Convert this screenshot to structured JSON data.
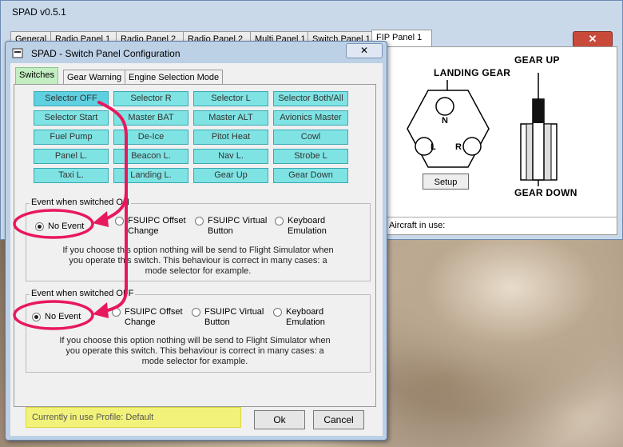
{
  "main_window": {
    "title": "SPAD    v0.5.1",
    "tabs": [
      "General",
      "Radio Panel 1",
      "Radio Panel 2",
      "Radio Panel 2",
      "Multi Panel 1",
      "Switch Panel 1",
      "FIP Panel 1"
    ],
    "active_tab": "Switch Panel 1",
    "close_label": "✕",
    "gear_panel": {
      "landing_gear_label": "LANDING GEAR",
      "gear_up_label": "GEAR UP",
      "gear_down_label": "GEAR DOWN",
      "nose_label": "N",
      "left_label": "L",
      "right_label": "R",
      "setup_label": "Setup"
    },
    "aircraft_label": "Aircraft in use:"
  },
  "dialog": {
    "title": "SPAD - Switch Panel Configuration",
    "close_label": "✕",
    "tabs": [
      "Switches",
      "Gear Warning",
      "Engine Selection Mode"
    ],
    "active_tab": "Switches",
    "switches": [
      [
        "Selector OFF",
        "Selector R",
        "Selector L",
        "Selector Both/All"
      ],
      [
        "Selector Start",
        "Master BAT",
        "Master ALT",
        "Avionics Master"
      ],
      [
        "Fuel Pump",
        "De-Ice",
        "Pitot Heat",
        "Cowl"
      ],
      [
        "Panel L.",
        "Beacon L.",
        "Nav L.",
        "Strobe L"
      ],
      [
        "Taxi L.",
        "Landing L.",
        "Gear Up",
        "Gear Down"
      ]
    ],
    "selected_switch": "Selector OFF",
    "event_on": {
      "legend": "Event when switched ON",
      "options": [
        {
          "label": "No Event",
          "checked": true
        },
        {
          "label": "FSUIPC Offset\nChange",
          "checked": false
        },
        {
          "label": "FSUIPC Virtual\nButton",
          "checked": false
        },
        {
          "label": "Keyboard\nEmulation",
          "checked": false
        }
      ],
      "help": "If you choose this option nothing will be send to Flight Simulator when\nyou operate this switch. This behaviour is correct in many cases: a\nmode selector for example."
    },
    "event_off": {
      "legend": "Event when switched OFF",
      "options": [
        {
          "label": "No Event",
          "checked": true
        },
        {
          "label": "FSUIPC Offset\nChange",
          "checked": false
        },
        {
          "label": "FSUIPC Virtual\nButton",
          "checked": false
        },
        {
          "label": "Keyboard\nEmulation",
          "checked": false
        }
      ],
      "help": "If you choose this option nothing will be send to Flight Simulator when\nyou operate this switch. This behaviour is correct in many cases: a\nmode selector for example."
    },
    "profile_text": "Currently in use Profile:  Default",
    "ok_label": "Ok",
    "cancel_label": "Cancel"
  },
  "colors": {
    "annotation": "#e8185e",
    "switch_button": "#7fe3e3",
    "active_tab": "#c2eec2",
    "profile_highlight": "#f2f27a"
  }
}
